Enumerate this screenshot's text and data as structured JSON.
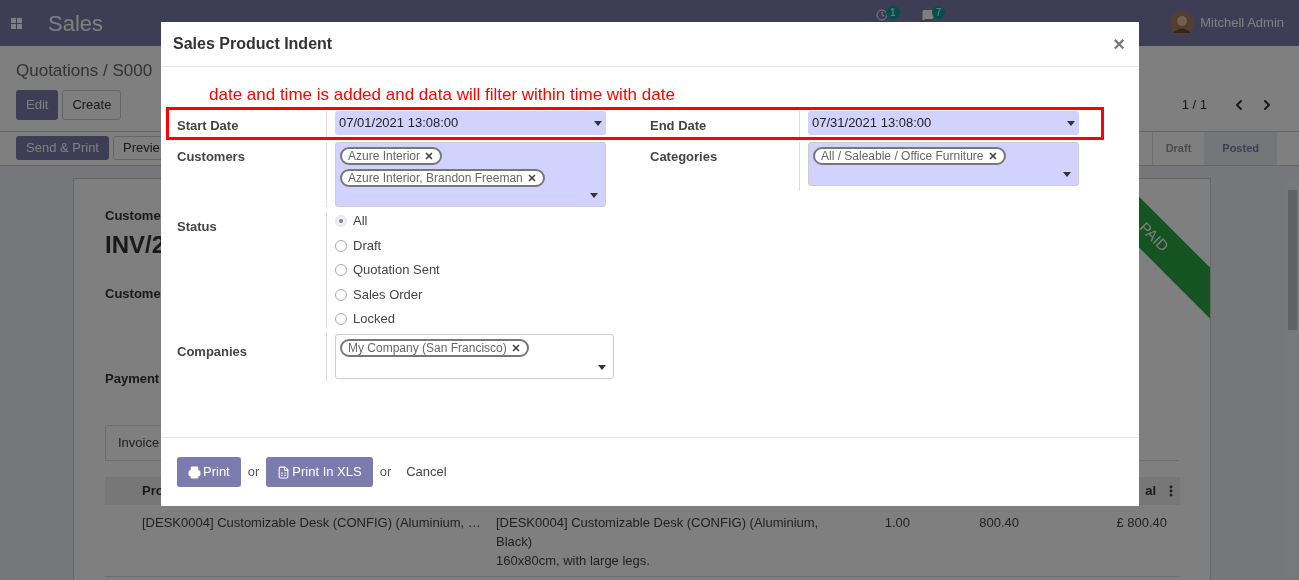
{
  "navbar": {
    "app_name": "Sales",
    "activity_count": "1",
    "message_count": "7",
    "user": "Mitchell Admin"
  },
  "breadcrumb": "Quotations / S000",
  "control_buttons": [
    "Edit",
    "Create"
  ],
  "pager": "1 / 1",
  "action_buttons": [
    "Send & Print",
    "Previe"
  ],
  "statusbar": [
    {
      "label": "Draft",
      "selected": false
    },
    {
      "label": "Posted",
      "selected": true
    }
  ],
  "sheet": {
    "ribbon": "PAID",
    "labels": [
      "Custome",
      "Custome",
      "Payment"
    ],
    "title": "INV/2",
    "tab": "Invoice",
    "columns": [
      "Pro",
      "al"
    ],
    "rows": [
      {
        "product": "[DESK0004] Customizable Desk (CONFIG) (Aluminium, …",
        "label_lines": [
          "[DESK0004] Customizable Desk (CONFIG) (Aluminium,",
          "Black)",
          "160x80cm, with large legs."
        ],
        "quantity": "1.00",
        "price": "800.40",
        "subtotal": "£ 800.40"
      }
    ]
  },
  "dialog": {
    "title": "Sales Product Indent",
    "close": "×",
    "annotation": "date and time is added and data will filter within time with date",
    "start_date": {
      "label": "Start Date",
      "value": "07/01/2021 13:08:00"
    },
    "end_date": {
      "label": "End Date",
      "value": "07/31/2021 13:08:00"
    },
    "customers": {
      "label": "Customers",
      "tags": [
        "Azure Interior",
        "Azure Interior, Brandon Freeman"
      ]
    },
    "categories": {
      "label": "Categories",
      "tags": [
        "All / Saleable / Office Furniture"
      ]
    },
    "status": {
      "label": "Status",
      "options": [
        {
          "label": "All",
          "selected": true
        },
        {
          "label": "Draft",
          "selected": false
        },
        {
          "label": "Quotation Sent",
          "selected": false
        },
        {
          "label": "Sales Order",
          "selected": false
        },
        {
          "label": "Locked",
          "selected": false
        }
      ]
    },
    "companies": {
      "label": "Companies",
      "tags": [
        "My Company (San Francisco)"
      ]
    },
    "footer": {
      "print": "Print",
      "or_1": "or",
      "print_xls": "Print In XLS",
      "or_2": "or",
      "cancel": "Cancel"
    }
  }
}
